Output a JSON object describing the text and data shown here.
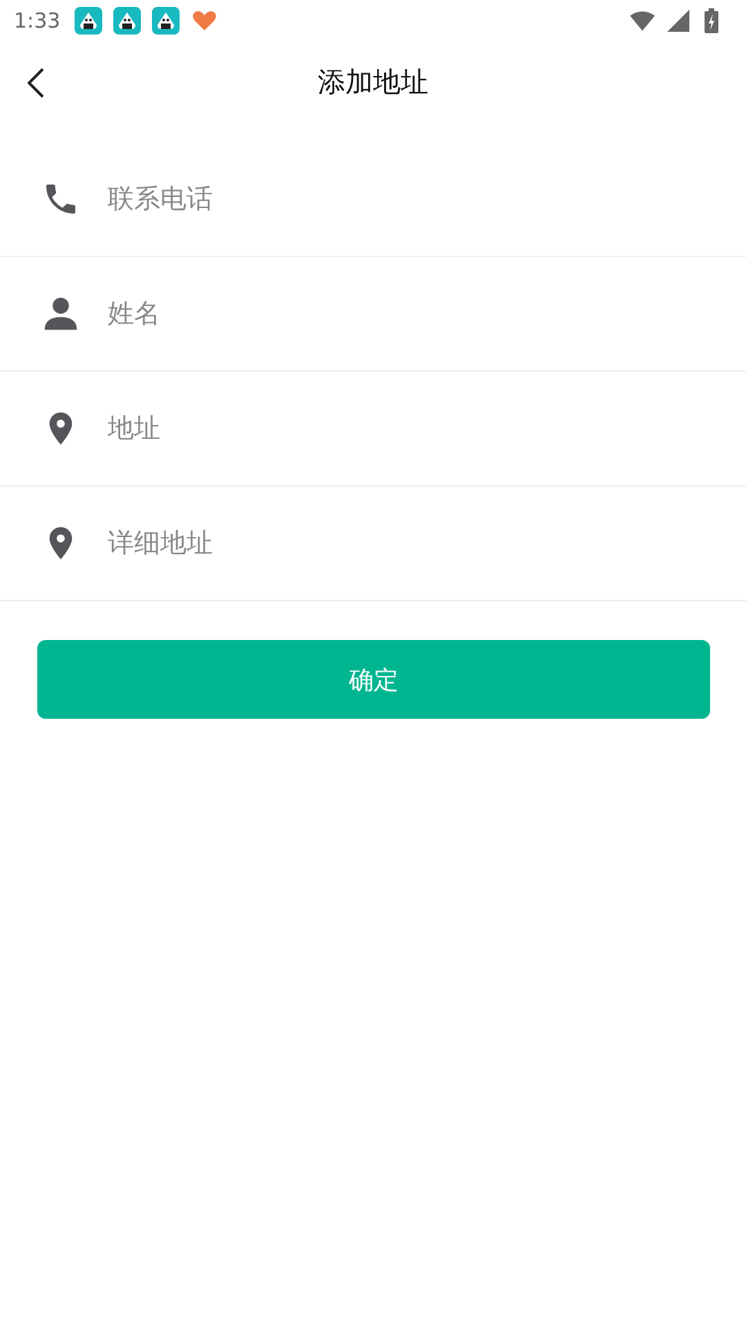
{
  "status_bar": {
    "time": "1:33",
    "notifications": [
      {
        "kind": "app"
      },
      {
        "kind": "app"
      },
      {
        "kind": "app"
      },
      {
        "kind": "heart"
      }
    ]
  },
  "header": {
    "title": "添加地址"
  },
  "fields": [
    {
      "kind": "phone",
      "placeholder": "联系电话"
    },
    {
      "kind": "person",
      "placeholder": "姓名"
    },
    {
      "kind": "location",
      "placeholder": "地址"
    },
    {
      "kind": "location",
      "placeholder": "详细地址"
    }
  ],
  "submit_button": "确定"
}
